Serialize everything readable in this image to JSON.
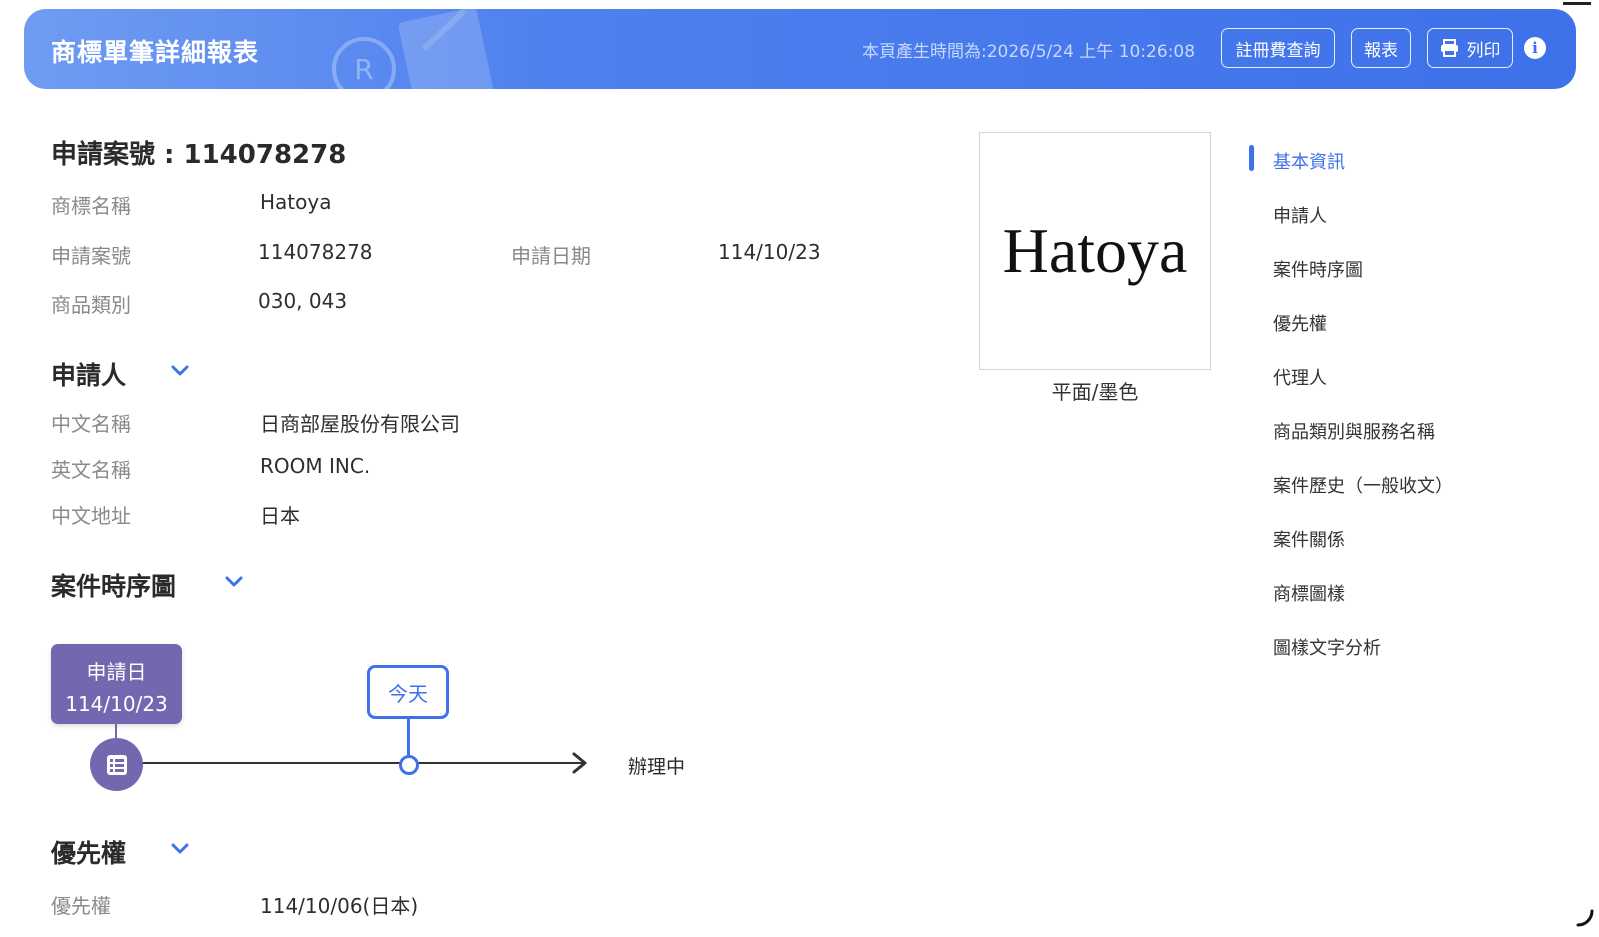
{
  "header": {
    "title": "商標單筆詳細報表",
    "generated_time": "本頁產生時間為:2026/5/24 上午 10:26:08",
    "fee_query_label": "註冊費查詢",
    "report_label": "報表",
    "print_label": "列印",
    "icons": [
      "print-icon",
      "info-icon"
    ],
    "accent_color": "#3e71ea"
  },
  "basic": {
    "case_title": "申請案號 : 114078278",
    "name_label": "商標名稱",
    "name_value": "Hatoya",
    "app_no_label": "申請案號",
    "app_no_value": "114078278",
    "app_date_label": "申請日期",
    "app_date_value": "114/10/23",
    "class_label": "商品類別",
    "class_value": "030, 043"
  },
  "trademark_image": {
    "text": "Hatoya",
    "caption": "平面/墨色"
  },
  "applicant": {
    "title": "申請人",
    "cn_name_label": "中文名稱",
    "cn_name_value": "日商部屋股份有限公司",
    "en_name_label": "英文名稱",
    "en_name_value": "ROOM INC.",
    "cn_addr_label": "中文地址",
    "cn_addr_value": "日本"
  },
  "timeline": {
    "title": "案件時序圖",
    "start_label": "申請日",
    "start_date": "114/10/23",
    "today_label": "今天",
    "status": "辦理中",
    "start_color": "#7268b0",
    "today_color": "#3e71ea"
  },
  "priority": {
    "title": "優先權",
    "label": "優先權",
    "value": "114/10/06(日本)"
  },
  "side_nav": {
    "items": [
      {
        "label": "基本資訊",
        "active": true
      },
      {
        "label": "申請人",
        "active": false
      },
      {
        "label": "案件時序圖",
        "active": false
      },
      {
        "label": "優先權",
        "active": false
      },
      {
        "label": "代理人",
        "active": false
      },
      {
        "label": "商品類別與服務名稱",
        "active": false
      },
      {
        "label": "案件歷史（一般收文）",
        "active": false
      },
      {
        "label": "案件關係",
        "active": false
      },
      {
        "label": "商標圖樣",
        "active": false
      },
      {
        "label": "圖樣文字分析",
        "active": false
      }
    ]
  }
}
